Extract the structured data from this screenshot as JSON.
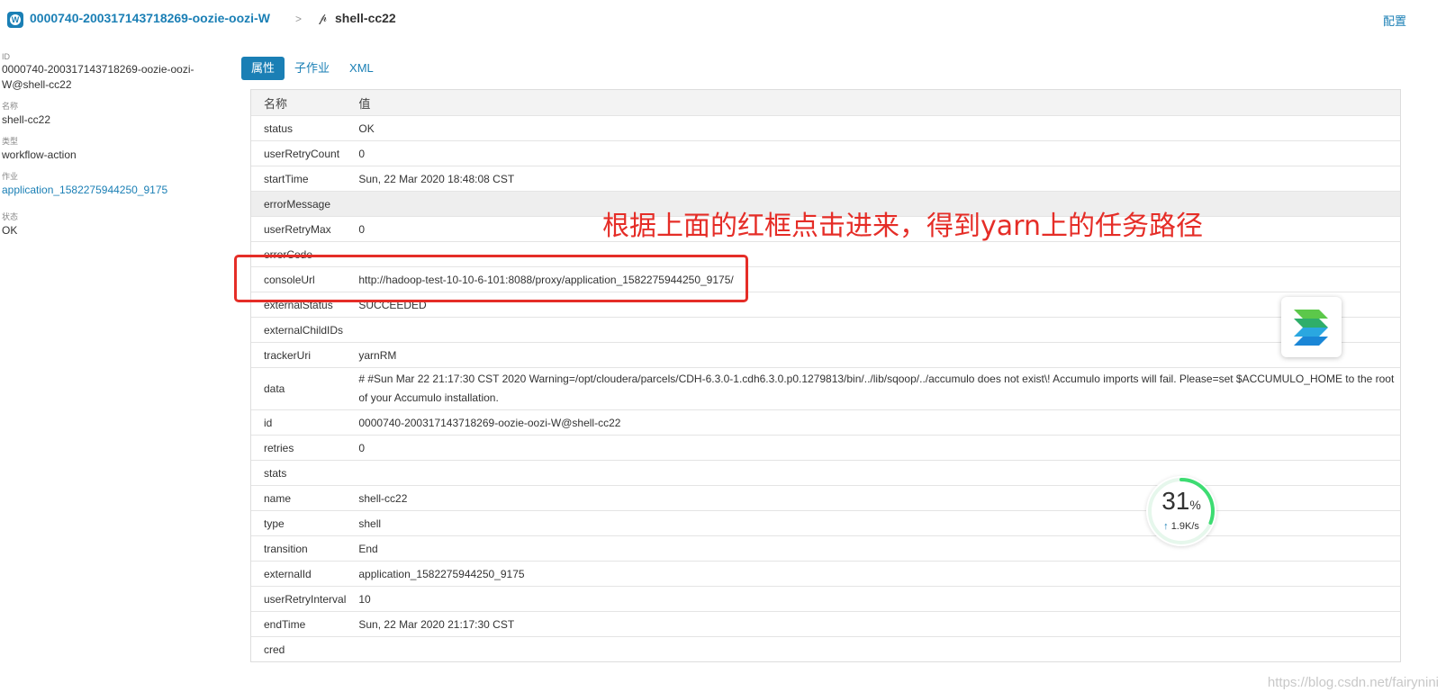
{
  "header": {
    "brand_letter": "W",
    "job_name": "0000740-200317143718269-oozie-oozi-W",
    "separator": ">",
    "action_icon": "branch-icon",
    "action_name": "shell-cc22",
    "config_label": "配置"
  },
  "sidebar": {
    "fields": [
      {
        "label": "ID",
        "value": "0000740-200317143718269-oozie-oozi-W@shell-cc22",
        "link": false
      },
      {
        "label": "名称",
        "value": "shell-cc22",
        "link": false
      },
      {
        "label": "类型",
        "value": "workflow-action",
        "link": false
      },
      {
        "label": "作业",
        "value": "application_1582275944250_9175",
        "link": true
      },
      {
        "label": "状态",
        "value": "OK",
        "link": false
      }
    ]
  },
  "tabs": [
    {
      "label": "属性",
      "active": true
    },
    {
      "label": "子作业",
      "active": false
    },
    {
      "label": "XML",
      "active": false
    }
  ],
  "table": {
    "headers": [
      "名称",
      "值"
    ],
    "rows": [
      {
        "key": "status",
        "value": "OK"
      },
      {
        "key": "userRetryCount",
        "value": "0"
      },
      {
        "key": "startTime",
        "value": "Sun, 22 Mar 2020 18:48:08 CST"
      },
      {
        "key": "errorMessage",
        "value": "",
        "highlight": true
      },
      {
        "key": "userRetryMax",
        "value": "0"
      },
      {
        "key": "errorCode",
        "value": ""
      },
      {
        "key": "consoleUrl",
        "value": "http://hadoop-test-10-10-6-101:8088/proxy/application_1582275944250_9175/"
      },
      {
        "key": "externalStatus",
        "value": "SUCCEEDED"
      },
      {
        "key": "externalChildIDs",
        "value": ""
      },
      {
        "key": "trackerUri",
        "value": "yarnRM"
      },
      {
        "key": "data",
        "value": "# #Sun Mar 22 21:17:30 CST 2020 Warning=/opt/cloudera/parcels/CDH-6.3.0-1.cdh6.3.0.p0.1279813/bin/../lib/sqoop/../accumulo does not exist\\! Accumulo imports will fail. Please=set $ACCUMULO_HOME to the root of your Accumulo installation.",
        "tall": true
      },
      {
        "key": "id",
        "value": "0000740-200317143718269-oozie-oozi-W@shell-cc22"
      },
      {
        "key": "retries",
        "value": "0"
      },
      {
        "key": "stats",
        "value": ""
      },
      {
        "key": "name",
        "value": "shell-cc22"
      },
      {
        "key": "type",
        "value": "shell"
      },
      {
        "key": "transition",
        "value": "End"
      },
      {
        "key": "externalId",
        "value": "application_1582275944250_9175"
      },
      {
        "key": "userRetryInterval",
        "value": "10"
      },
      {
        "key": "endTime",
        "value": "Sun, 22 Mar 2020 21:17:30 CST"
      },
      {
        "key": "cred",
        "value": ""
      }
    ]
  },
  "annotation": {
    "text": "根据上面的红框点击进来，得到yarn上的任务路径",
    "color": "#e52d27"
  },
  "speed_widget": {
    "percent": "31",
    "percent_sign": "%",
    "rate": "1.9K/s",
    "progress": 0.31,
    "ring_color": "#3ddc72"
  },
  "watermark": "https://blog.csdn.net/fairynini",
  "colors": {
    "accent": "#1a7fb5"
  }
}
